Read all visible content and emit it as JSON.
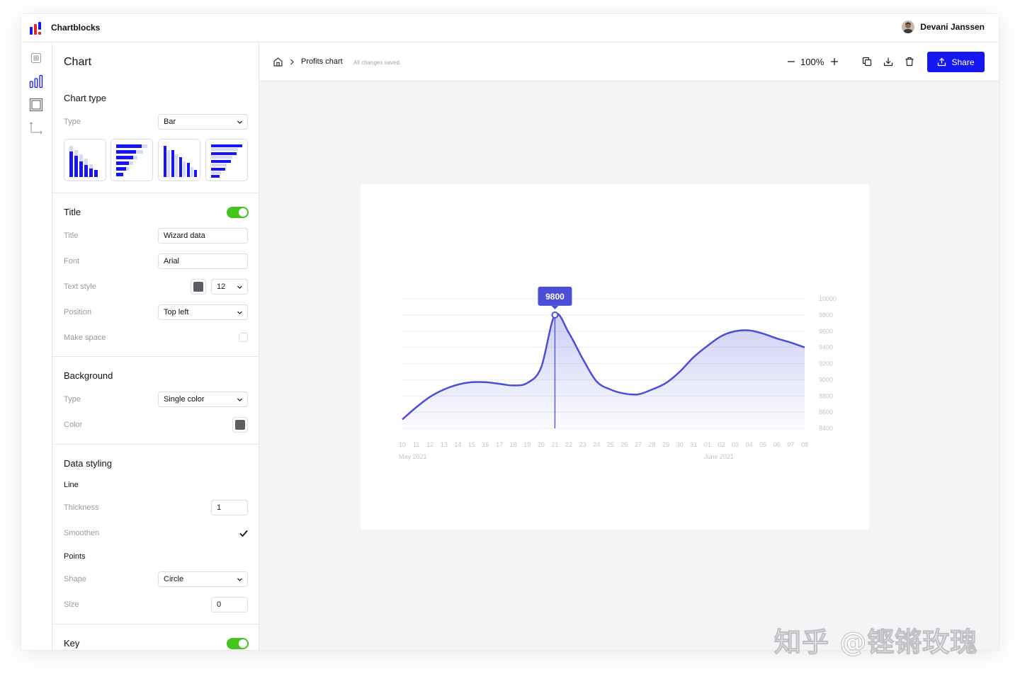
{
  "app": {
    "name": "Chartblocks",
    "user_name": "Devani Janssen"
  },
  "rail": {
    "items": [
      "data-icon",
      "chart-icon",
      "layout-icon",
      "axes-icon"
    ]
  },
  "panel": {
    "title": "Chart",
    "chart_type": {
      "heading": "Chart type",
      "type_label": "Type",
      "type_value": "Bar",
      "variants": [
        "vertical-bar",
        "horizontal-bar",
        "vertical-bar-grouped",
        "horizontal-bar-grouped"
      ]
    },
    "title_section": {
      "heading": "Title",
      "enabled": true,
      "title_label": "Title",
      "title_value": "Wizard data",
      "font_label": "Font",
      "font_value": "Arial",
      "text_style_label": "Text style",
      "text_size": "12",
      "position_label": "Position",
      "position_value": "Top left",
      "make_space_label": "Make space",
      "make_space_checked": false
    },
    "background": {
      "heading": "Background",
      "type_label": "Type",
      "type_value": "Single color",
      "color_label": "Color",
      "color_value": "#5e5e62"
    },
    "data_styling": {
      "heading": "Data styling",
      "line_heading": "Line",
      "thickness_label": "Thickness",
      "thickness_value": "1",
      "smoothen_label": "Smoothen",
      "smoothen_checked": true,
      "points_heading": "Points",
      "shape_label": "Shape",
      "shape_value": "Circle",
      "size_label": "Size",
      "size_value": "0"
    },
    "key": {
      "heading": "Key",
      "enabled": true
    }
  },
  "toolbar": {
    "breadcrumb": "Profits chart",
    "save_status": "All changes saved.",
    "zoom": "100%",
    "share_label": "Share"
  },
  "colors": {
    "accent": "#1616f2",
    "line": "#4a4fd6",
    "toggle": "#43c51d"
  },
  "chart_data": {
    "type": "area",
    "x": [
      "10",
      "11",
      "12",
      "13",
      "14",
      "15",
      "16",
      "17",
      "18",
      "19",
      "20",
      "21",
      "22",
      "23",
      "24",
      "25",
      "26",
      "27",
      "28",
      "29",
      "30",
      "31",
      "01",
      "02",
      "03",
      "04",
      "05",
      "06",
      "07",
      "08"
    ],
    "x_groups": [
      {
        "label": "May 2021",
        "start": "10"
      },
      {
        "label": "June 2021",
        "start": "01"
      }
    ],
    "series": [
      {
        "values": [
          8510,
          8660,
          8790,
          8880,
          8940,
          8970,
          8970,
          8950,
          8930,
          8960,
          9150,
          9800,
          9580,
          9260,
          8980,
          8880,
          8830,
          8820,
          8880,
          8960,
          9100,
          9280,
          9420,
          9540,
          9600,
          9610,
          9570,
          9510,
          9460,
          9400
        ]
      }
    ],
    "ylim": [
      8400,
      10000
    ],
    "yticks": [
      "10000",
      "9800",
      "9600",
      "9400",
      "9200",
      "9000",
      "8800",
      "8600",
      "8400"
    ],
    "y_axis_side": "right",
    "grid": true,
    "highlight": {
      "x": "21",
      "label": "9800"
    }
  }
}
